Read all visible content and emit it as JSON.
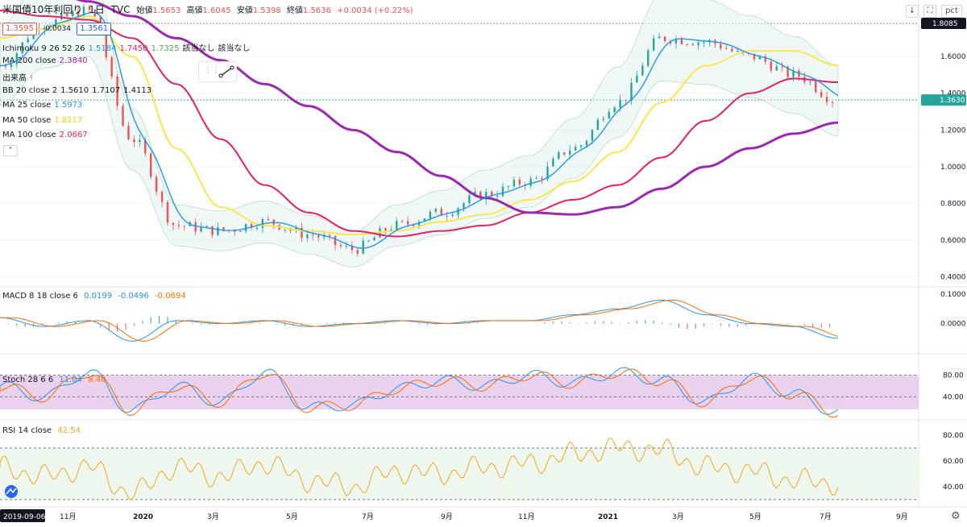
{
  "header": {
    "symbol": "米国債10年利回り",
    "interval": "1日",
    "source": "TVC",
    "ohlc": {
      "open_label": "始値",
      "open": "1.5653",
      "high_label": "高値",
      "high": "1.6045",
      "low_label": "安値",
      "low": "1.5398",
      "close_label": "終値",
      "close": "1.5636",
      "change": "+0.0034 (+0.22%)"
    },
    "bid": "1.3595",
    "spread": "-0.0034",
    "ask": "1.3561",
    "scale_label": "pct"
  },
  "indicators": [
    {
      "name": "Ichimoku 9 26 52 26",
      "values": [
        "1.5184",
        "1.7450",
        "1.7325",
        "該当なし",
        "該当なし"
      ],
      "colors": [
        "#2196f3",
        "#e91e63",
        "#4caf50",
        "#131722",
        "#131722"
      ]
    },
    {
      "name": "MA 200 close",
      "values": [
        "2.3840"
      ],
      "colors": [
        "#9c27b0"
      ]
    },
    {
      "name": "出来高",
      "values": [
        "!"
      ],
      "colors": [
        "#ef5350"
      ]
    },
    {
      "name": "BB 20 close 2",
      "values": [
        "1.5610",
        "1.7107",
        "1.4113"
      ],
      "colors": [
        "#131722",
        "#131722",
        "#131722"
      ]
    },
    {
      "name": "MA 25 close",
      "values": [
        "1.5973"
      ],
      "colors": [
        "#2196f3"
      ]
    },
    {
      "name": "MA 50 close",
      "values": [
        "1.8217"
      ],
      "colors": [
        "#f5d300"
      ]
    },
    {
      "name": "MA 100 close",
      "values": [
        "2.0667"
      ],
      "colors": [
        "#e91e63"
      ]
    }
  ],
  "collapse_icon": "chevron-up-icon",
  "sub_panes": {
    "macd": {
      "name": "MACD 8 18 close 6",
      "values": [
        "0.0199",
        "-0.0496",
        "-0.0694"
      ],
      "colors": [
        "#2196f3",
        "#2196f3",
        "#ff6d00"
      ]
    },
    "stoch": {
      "name": "Stoch 28 6 6",
      "values": [
        "11.04",
        "8.40"
      ],
      "colors": [
        "#2196f3",
        "#ff6d00"
      ]
    },
    "rsi": {
      "name": "RSI 14 close",
      "values": [
        "42.54"
      ],
      "colors": [
        "#f5a623"
      ]
    }
  },
  "price_axis": {
    "ticks": [
      "1.6000",
      "1.4000",
      "1.2000",
      "1.0000",
      "0.8000",
      "0.6000",
      "0.4000"
    ],
    "high_badge": "1.8085",
    "last_badge": "1.3630"
  },
  "macd_axis": {
    "ticks": [
      "0.1000",
      "0.0000"
    ]
  },
  "stoch_axis": {
    "ticks": [
      "80.00",
      "40.00"
    ]
  },
  "rsi_axis": {
    "ticks": [
      "80.00",
      "60.00",
      "40.00"
    ]
  },
  "time_axis": {
    "start_badge": "2019-09-06",
    "labels": [
      "11月",
      "2020",
      "3月",
      "5月",
      "7月",
      "9月",
      "11月",
      "2021",
      "3月",
      "5月",
      "7月",
      "9月"
    ]
  },
  "chart_data": {
    "type": "line",
    "title": "米国債10年利回り 1日 TVC",
    "x": [
      "2019-09",
      "2019-11",
      "2020-01",
      "2020-03",
      "2020-04",
      "2020-05",
      "2020-06",
      "2020-07",
      "2020-08",
      "2020-09",
      "2020-10",
      "2020-11",
      "2020-12",
      "2021-01",
      "2021-02",
      "2021-03",
      "2021-04",
      "2021-05",
      "2021-06",
      "2021-07"
    ],
    "series": [
      {
        "name": "終値",
        "values": [
          1.55,
          1.78,
          1.85,
          1.15,
          0.68,
          0.65,
          0.7,
          0.63,
          0.55,
          0.68,
          0.75,
          0.85,
          0.92,
          1.1,
          1.35,
          1.7,
          1.68,
          1.6,
          1.5,
          1.36
        ]
      },
      {
        "name": "MA 200 close",
        "values": [
          2.05,
          1.98,
          1.9,
          1.82,
          1.7,
          1.58,
          1.45,
          1.33,
          1.2,
          1.08,
          0.95,
          0.83,
          0.75,
          0.74,
          0.78,
          0.88,
          1.0,
          1.1,
          1.18,
          1.24
        ]
      },
      {
        "name": "MA 100 close",
        "values": [
          1.85,
          1.82,
          1.8,
          1.7,
          1.45,
          1.15,
          0.9,
          0.75,
          0.65,
          0.62,
          0.65,
          0.68,
          0.75,
          0.82,
          0.9,
          1.05,
          1.25,
          1.4,
          1.48,
          1.46
        ]
      },
      {
        "name": "MA 50 close",
        "values": [
          1.7,
          1.75,
          1.82,
          1.6,
          1.1,
          0.78,
          0.68,
          0.65,
          0.63,
          0.65,
          0.7,
          0.74,
          0.82,
          0.92,
          1.08,
          1.35,
          1.55,
          1.63,
          1.63,
          1.55
        ]
      }
    ],
    "ylim": [
      0.35,
      1.82
    ],
    "macd": {
      "values": [
        0.02,
        -0.01,
        0.01,
        -0.06,
        0.01,
        0.0,
        0.01,
        -0.01,
        0.0,
        0.01,
        0.0,
        0.01,
        0.01,
        0.03,
        0.05,
        0.08,
        0.03,
        0.0,
        -0.01,
        -0.05
      ]
    },
    "stoch": {
      "values": [
        60,
        40,
        85,
        15,
        60,
        30,
        85,
        20,
        25,
        55,
        70,
        60,
        80,
        65,
        85,
        70,
        30,
        75,
        45,
        11
      ]
    },
    "rsi": {
      "values": [
        55,
        48,
        55,
        35,
        55,
        48,
        58,
        45,
        40,
        52,
        50,
        55,
        58,
        65,
        70,
        68,
        55,
        52,
        45,
        42.54
      ]
    }
  },
  "colors": {
    "up": "#26a69a",
    "down": "#ef5350",
    "ma200": "#9c27b0",
    "ma100": "#e91e63",
    "ma50": "#fbe54a",
    "ma25": "#2196f3",
    "stoch_fill": "#e1bee7",
    "rsi_fill": "#e8f5e9"
  }
}
